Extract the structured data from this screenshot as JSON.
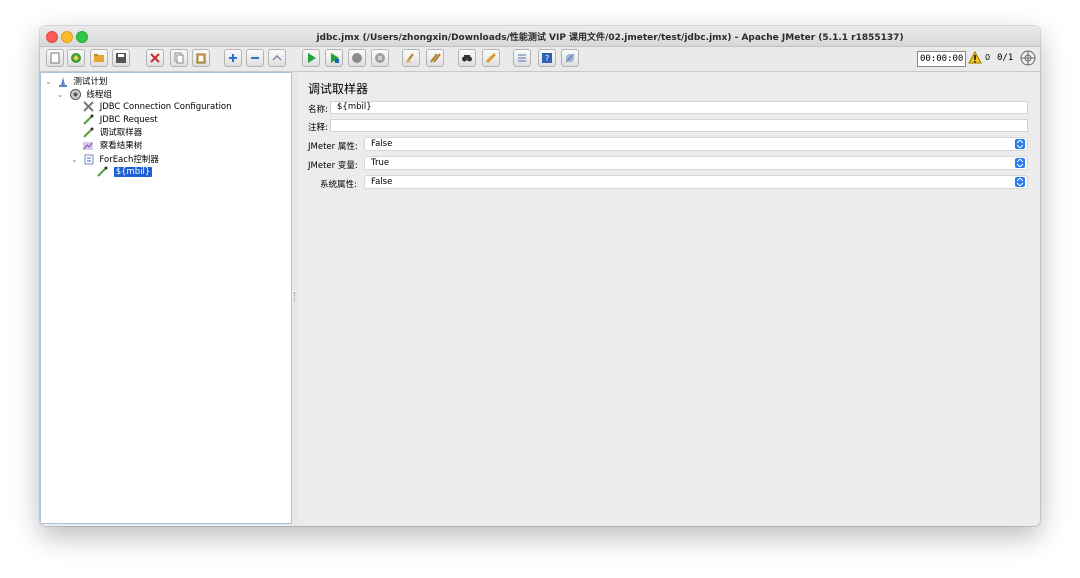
{
  "window": {
    "title": "jdbc.jmx (/Users/zhongxin/Downloads/性能测试 VIP 课用文件/02.jmeter/test/jdbc.jmx) - Apache JMeter (5.1.1 r1855137)"
  },
  "toolbar": {
    "buttons": [
      "new-icon",
      "templates-icon",
      "open-icon",
      "save-icon",
      "cut-icon",
      "copy-icon",
      "paste-icon",
      "expand-icon",
      "collapse-icon",
      "toggle-icon",
      "start-icon",
      "start-no-pause-icon",
      "stop-icon",
      "shutdown-icon",
      "clear-icon",
      "clear-all-icon",
      "search-icon",
      "reset-search-icon",
      "function-helper-icon",
      "help-icon",
      "remote-icon"
    ],
    "timer": "00:00:00",
    "warnings": "0",
    "threads": "0/1"
  },
  "tree": {
    "items": [
      {
        "label": "测试计划",
        "icon": "test-plan-icon",
        "expanded": true
      },
      {
        "label": "线程组",
        "icon": "thread-group-icon",
        "expanded": true
      },
      {
        "label": "JDBC Connection Configuration",
        "icon": "config-icon"
      },
      {
        "label": "JDBC Request",
        "icon": "sampler-icon"
      },
      {
        "label": "调试取样器",
        "icon": "sampler-icon"
      },
      {
        "label": "察看结果树",
        "icon": "listener-icon"
      },
      {
        "label": "ForEach控制器",
        "icon": "controller-icon",
        "expanded": true
      },
      {
        "label": "${mbil}",
        "icon": "sampler-icon",
        "selected": true
      }
    ]
  },
  "editor": {
    "title": "调试取样器",
    "name_label": "名称:",
    "name_value": "${mbil}",
    "comment_label": "注释:",
    "comment_value": "",
    "jmeter_props_label": "JMeter 属性:",
    "jmeter_props_value": "False",
    "jmeter_vars_label": "JMeter 变量:",
    "jmeter_vars_value": "True",
    "system_props_label": "系统属性:",
    "system_props_value": "False"
  },
  "colors": {
    "accent": "#2b7bf2",
    "selection": "#1f5fd6"
  }
}
